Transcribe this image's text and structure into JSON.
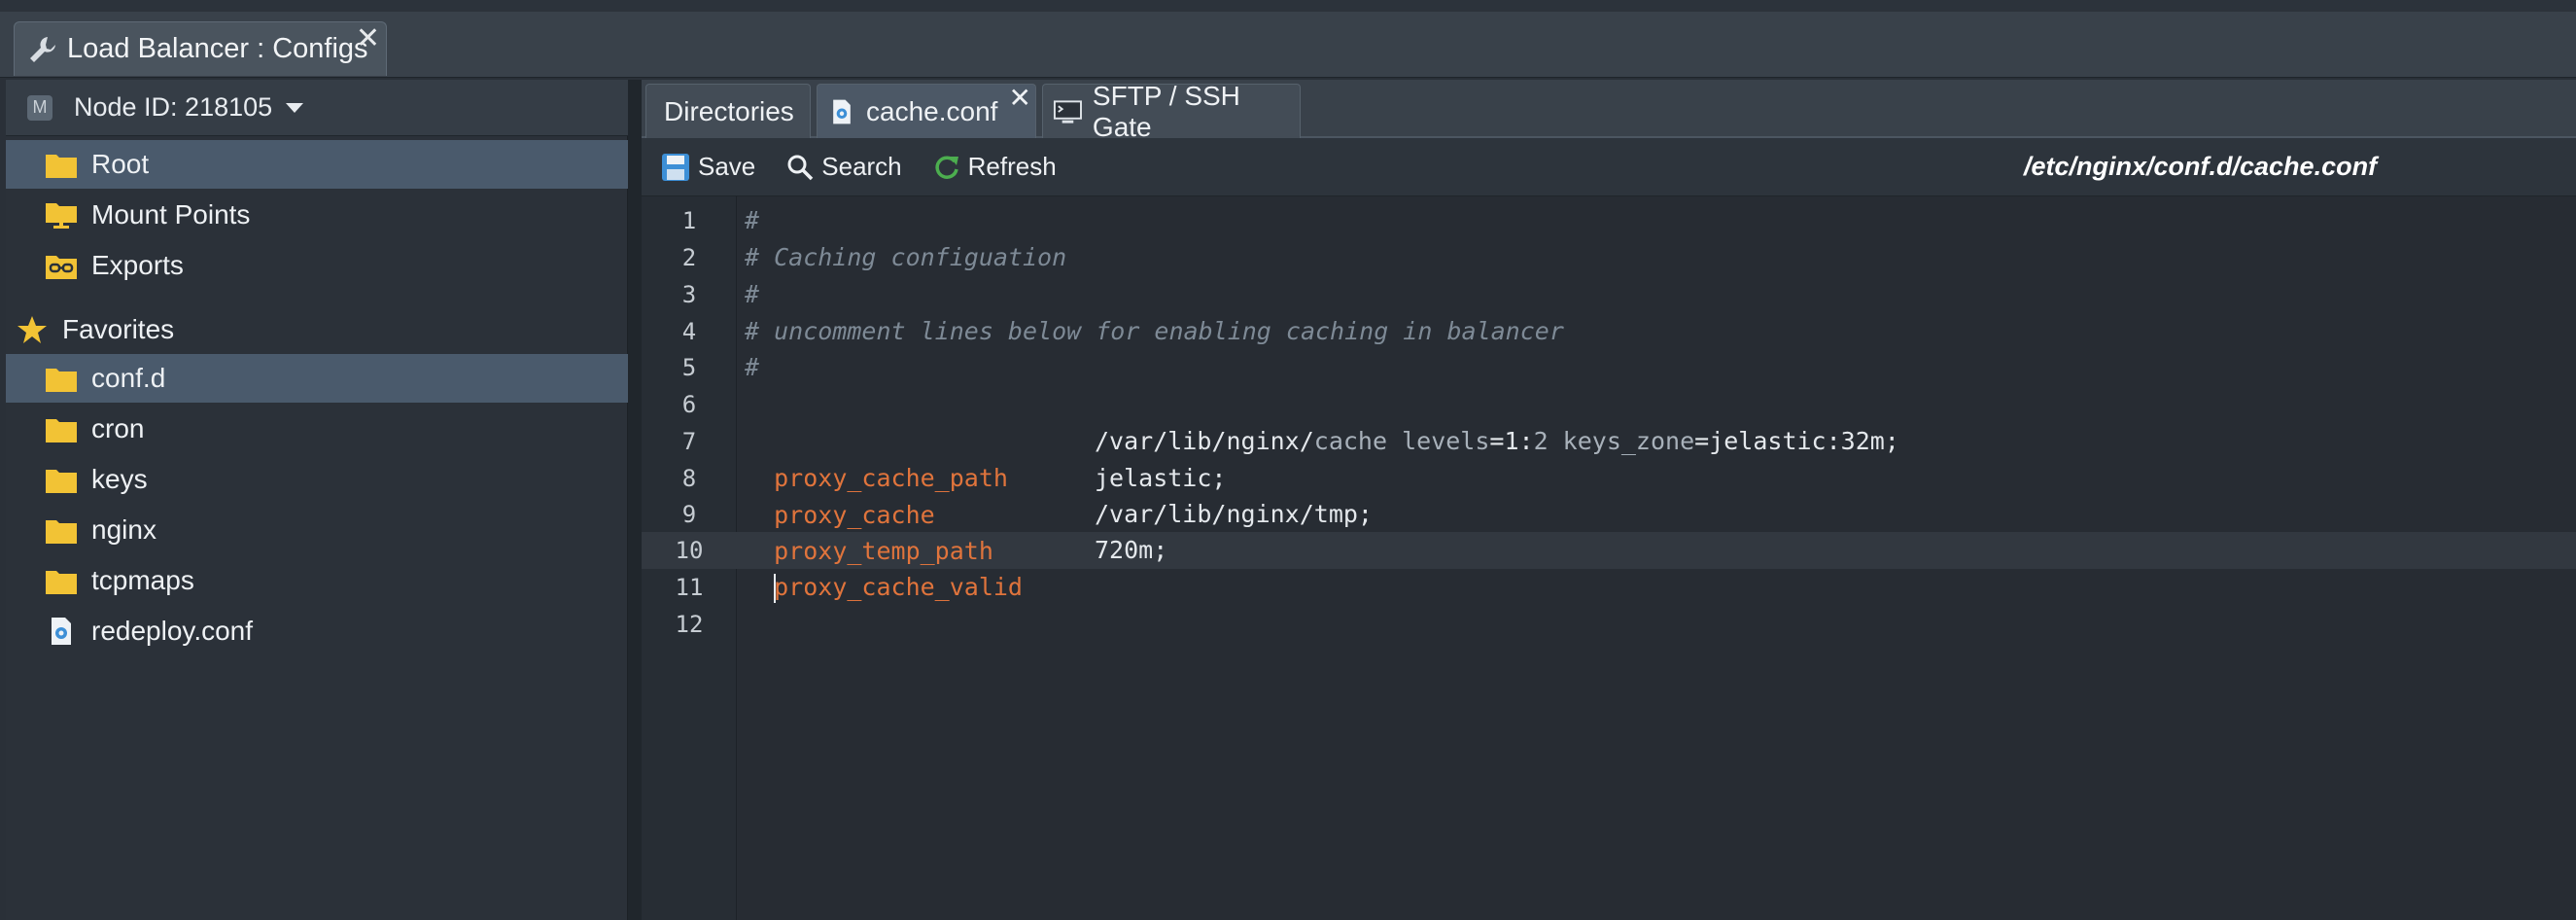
{
  "window": {
    "title": "Load Balancer : Configs",
    "close_glyph": "✕"
  },
  "sidebar": {
    "node_label": "Node ID: 218105",
    "node_badge": "M",
    "items": [
      {
        "label": "Root",
        "icon": "folder-icon"
      },
      {
        "label": "Mount Points",
        "icon": "mount-folder-icon"
      },
      {
        "label": "Exports",
        "icon": "exports-icon"
      }
    ],
    "favorites_label": "Favorites",
    "favorites": [
      {
        "label": "conf.d",
        "icon": "folder-icon"
      },
      {
        "label": "cron",
        "icon": "folder-icon"
      },
      {
        "label": "keys",
        "icon": "folder-icon"
      },
      {
        "label": "nginx",
        "icon": "folder-icon"
      },
      {
        "label": "tcpmaps",
        "icon": "folder-icon"
      },
      {
        "label": "redeploy.conf",
        "icon": "config-file-icon"
      }
    ]
  },
  "tabs": [
    {
      "label": "Directories"
    },
    {
      "label": "cache.conf"
    },
    {
      "label": "SFTP / SSH Gate"
    }
  ],
  "toolbar": {
    "save_label": "Save",
    "search_label": "Search",
    "refresh_label": "Refresh",
    "file_path": "/etc/nginx/conf.d/cache.conf"
  },
  "editor": {
    "line_numbers": [
      "1",
      "2",
      "3",
      "4",
      "5",
      "6",
      "7",
      "8",
      "9",
      "10",
      "11",
      "12"
    ],
    "lines": {
      "l1": "#",
      "l2": "# Caching configuation",
      "l3": "#",
      "l4": "# uncomment lines below for enabling caching in balancer",
      "l5": "#",
      "l7_directive": "proxy_cache_path",
      "l7_value_a": "/var/lib/nginx/",
      "l7_value_b": "cache levels",
      "l7_value_c": "=1:",
      "l7_value_d": "2 keys_zone",
      "l7_value_e": "=jelastic:32m;",
      "l8_directive": "proxy_cache",
      "l8_value": "jelastic;",
      "l9_directive": "proxy_temp_path",
      "l9_value": "/var/lib/nginx/tmp;",
      "l10_directive": "proxy_cache_valid",
      "l10_value": "720m;"
    }
  },
  "colors": {
    "selected_row": "#4a5a6c",
    "directive": "#e0743c",
    "comment": "#7e8a96",
    "folder": "#f2c335"
  }
}
